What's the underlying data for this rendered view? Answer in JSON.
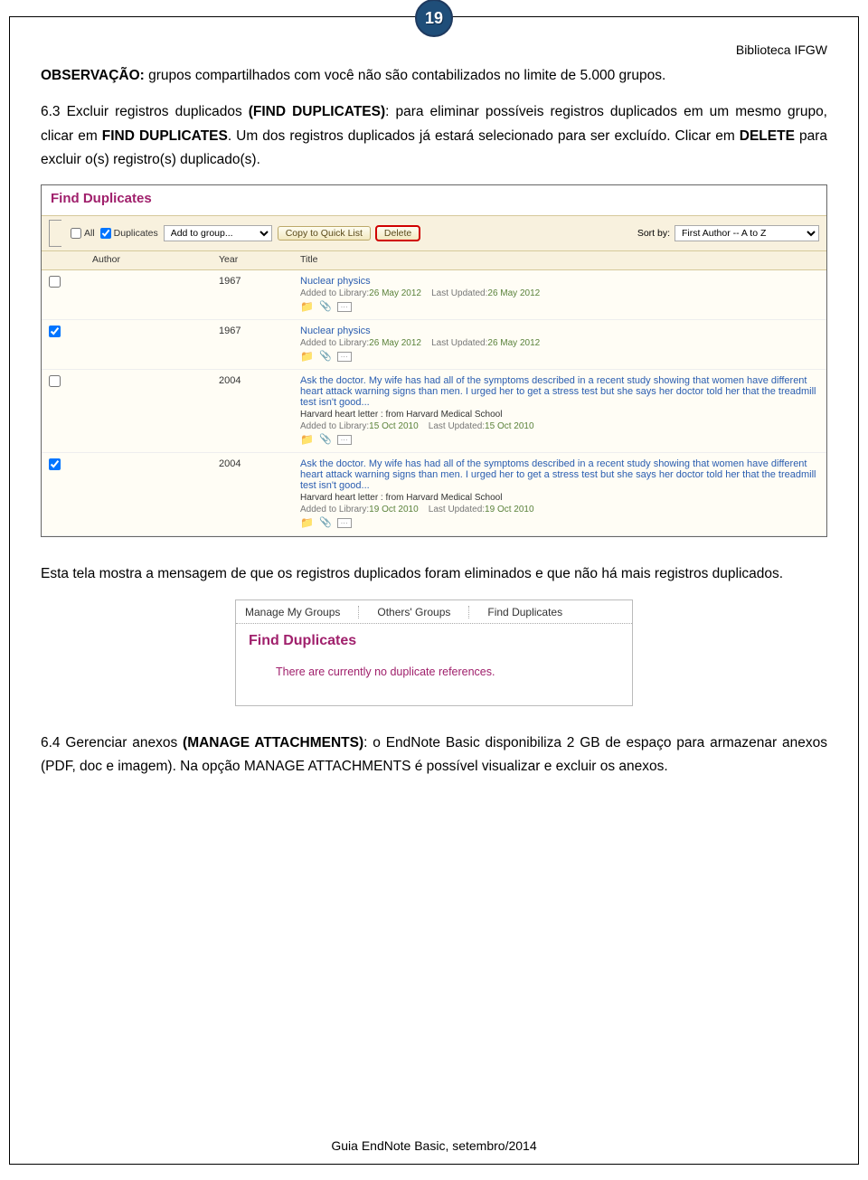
{
  "page": {
    "number": "19",
    "header_right": "Biblioteca IFGW",
    "footer": "Guia EndNote Basic, setembro/2014"
  },
  "para1a": "OBSERVAÇÃO:",
  "para1b": " grupos compartilhados com você não são contabilizados no limite de 5.000 grupos.",
  "para2a": "6.3 Excluir registros duplicados ",
  "para2b": "(FIND DUPLICATES)",
  "para2c": ": para eliminar possíveis registros duplicados em um mesmo grupo, clicar em ",
  "para2d": "FIND DUPLICATES",
  "para2e": ". Um dos registros duplicados já estará selecionado para ser excluído. Clicar em ",
  "para2f": "DELETE",
  "para2g": " para excluir o(s) registro(s) duplicado(s).",
  "fd": {
    "title": "Find Duplicates",
    "all_label": "All",
    "dup_label": "Duplicates",
    "addgroup": "Add to group...",
    "copyquick": "Copy to Quick List",
    "delete": "Delete",
    "sortby": "Sort by:",
    "sortval": "First Author -- A to Z",
    "col_author": "Author",
    "col_year": "Year",
    "col_title": "Title",
    "rows": [
      {
        "checked": false,
        "year": "1967",
        "title": "Nuclear physics",
        "added": "Added to Library:",
        "added_date": "26 May 2012",
        "updated": "Last Updated:",
        "updated_date": "26 May 2012",
        "harvard": ""
      },
      {
        "checked": true,
        "year": "1967",
        "title": "Nuclear physics",
        "added": "Added to Library:",
        "added_date": "26 May 2012",
        "updated": "Last Updated:",
        "updated_date": "26 May 2012",
        "harvard": ""
      },
      {
        "checked": false,
        "year": "2004",
        "title": "Ask the doctor. My wife has had all of the symptoms described in a recent study showing that women have different heart attack warning signs than men. I urged her to get a stress test but she says her doctor told her that the treadmill test isn't good...",
        "harvard": "Harvard heart letter : from Harvard Medical School",
        "added": "Added to Library:",
        "added_date": "15 Oct 2010",
        "updated": "Last Updated:",
        "updated_date": "15 Oct 2010"
      },
      {
        "checked": true,
        "year": "2004",
        "title": "Ask the doctor. My wife has had all of the symptoms described in a recent study showing that women have different heart attack warning signs than men. I urged her to get a stress test but she says her doctor told her that the treadmill test isn't good...",
        "harvard": "Harvard heart letter : from Harvard Medical School",
        "added": "Added to Library:",
        "added_date": "19 Oct 2010",
        "updated": "Last Updated:",
        "updated_date": "19 Oct 2010"
      }
    ]
  },
  "para3": "Esta tela mostra a mensagem de que os registros duplicados foram eliminados e que não há mais registros duplicados.",
  "tabs": {
    "t1": "Manage My Groups",
    "t2": "Others' Groups",
    "t3": "Find Duplicates",
    "title": "Find Duplicates",
    "msg": "There are currently no duplicate references."
  },
  "para4a": "6.4 Gerenciar anexos ",
  "para4b": "(MANAGE ATTACHMENTS)",
  "para4c": ": o EndNote Basic disponibiliza 2 GB de espaço para armazenar anexos (PDF, doc e imagem). Na opção MANAGE ATTACHMENTS é possível visualizar e excluir os anexos."
}
